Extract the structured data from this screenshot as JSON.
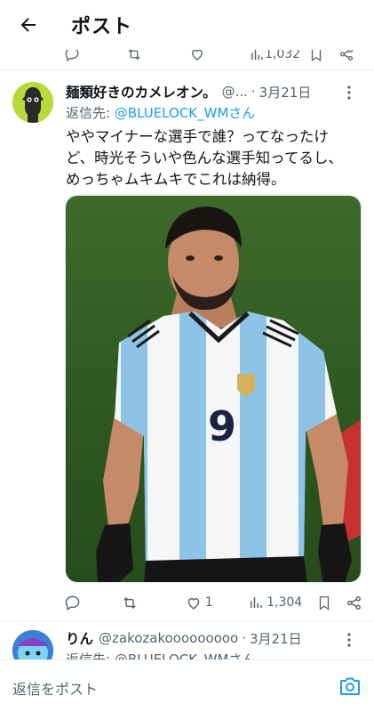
{
  "header": {
    "title": "ポスト"
  },
  "prev_actions": {
    "views": "1,032"
  },
  "tweet": {
    "name": "麺類好きのカメレオン。",
    "handle": "@...",
    "dot": "·",
    "date": "3月21日",
    "reply_prefix": "返信先: ",
    "reply_mention": "@BLUELOCK_WMさん",
    "text_lines": [
      "ややマイナーな選手で誰？ってなったけ",
      "ど、時光そういや色んな選手知ってるし、",
      "めっちゃムキムキでこれは納得。"
    ],
    "photo_number": "9",
    "actions": {
      "likes": "1",
      "views": "1,304"
    }
  },
  "next_tweet": {
    "name": "りん",
    "handle": "@zakozakooooooooo",
    "dot": "·",
    "date": "3月21日",
    "reply_preview": "返信先: @BLUELOCK_WMさん"
  },
  "reply_bar": {
    "placeholder": "返信をポスト"
  },
  "colors": {
    "accent": "#1d9bf0",
    "secondary_text": "#536471"
  }
}
